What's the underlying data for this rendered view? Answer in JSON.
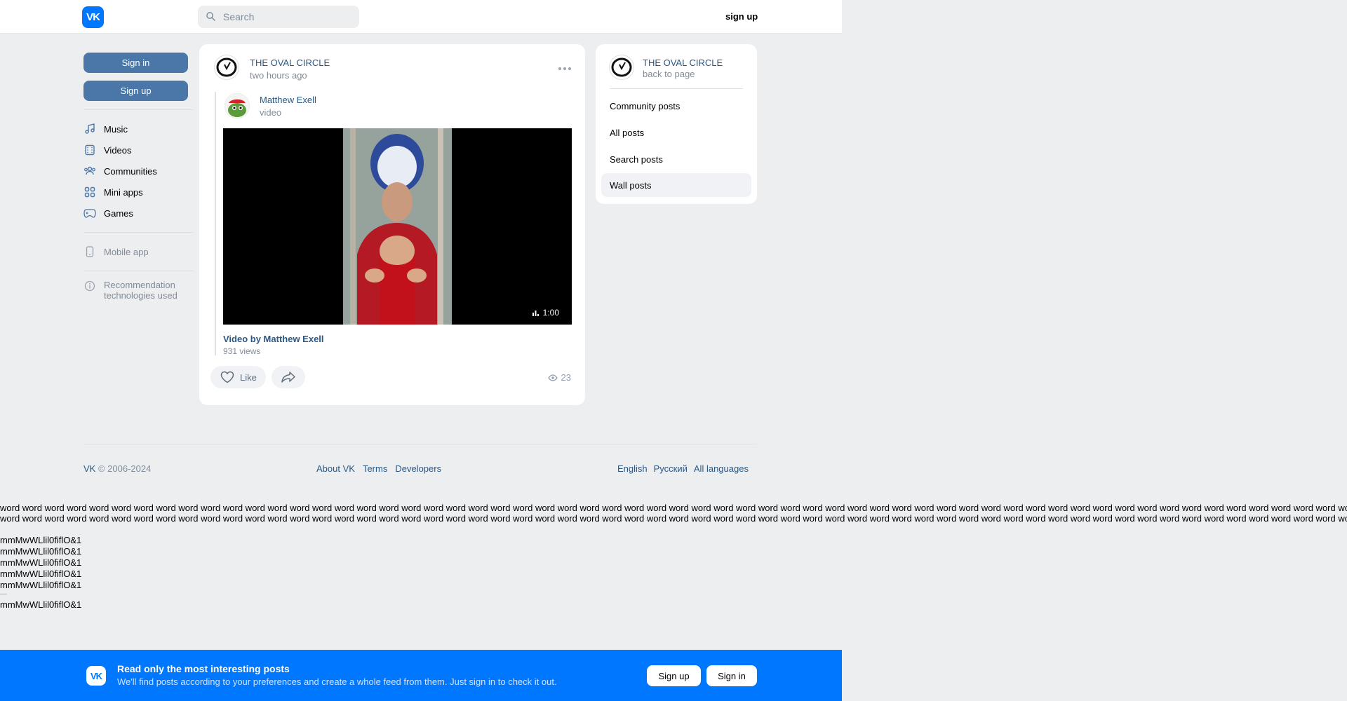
{
  "header": {
    "logo": "VK",
    "search_placeholder": "Search",
    "signup_label": "sign up"
  },
  "leftnav": {
    "signin_label": "Sign in",
    "signup_label": "Sign up",
    "items": [
      {
        "label": "Music",
        "icon": "music-icon"
      },
      {
        "label": "Videos",
        "icon": "video-icon"
      },
      {
        "label": "Communities",
        "icon": "communities-icon"
      },
      {
        "label": "Mini apps",
        "icon": "mini-apps-icon"
      },
      {
        "label": "Games",
        "icon": "games-icon"
      }
    ],
    "mobile_app": "Mobile app",
    "recommendation": "Recommendation technologies used"
  },
  "post": {
    "community": "THE OVAL CIRCLE",
    "time": "two hours ago",
    "repost": {
      "author": "Matthew Exell",
      "type": "video",
      "video_duration": "1:00",
      "video_title": "Video by Matthew Exell",
      "video_views": "931 views"
    },
    "like_label": "Like",
    "views_count": "23"
  },
  "rightpanel": {
    "community": "THE OVAL CIRCLE",
    "back": "back to page",
    "items": [
      {
        "label": "Community posts"
      },
      {
        "label": "All posts"
      },
      {
        "label": "Search posts"
      },
      {
        "label": "Wall posts",
        "active": true
      }
    ]
  },
  "footer": {
    "copyright_vk": "VK",
    "copyright_years": "© 2006-2024",
    "links": [
      "About VK",
      "Terms",
      "Developers"
    ],
    "languages": [
      "English",
      "Русский",
      "All languages"
    ]
  },
  "test": {
    "word_line": "word word word word word word word word word word word word word word word word word word word word word word word word word word word word word word word word word word word word word word word word word word word word word word word word word word word word word word word word word word word word word word",
    "sample": "mmMwWLlil0fiflO&1"
  },
  "banner": {
    "logo": "VK",
    "title": "Read only the most interesting posts",
    "subtitle": "We'll find posts according to your preferences and create a whole feed from them. Just sign in to check it out.",
    "signup_label": "Sign up",
    "signin_label": "Sign in"
  }
}
